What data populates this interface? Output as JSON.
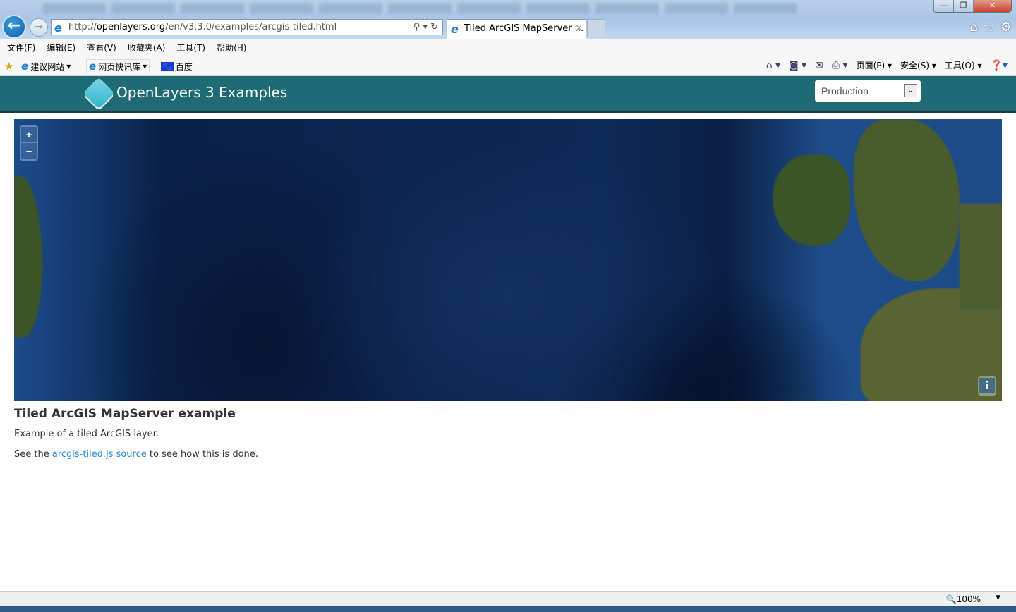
{
  "browser": {
    "address": {
      "prefix": "http://",
      "domain": "openlayers.org",
      "path": "/en/v3.3.0/examples/arcgis-tiled.html"
    },
    "tab_title": "Tiled ArcGIS MapServer ...",
    "tab_close": "×",
    "window_controls": {
      "minimize": "—",
      "restore": "❐",
      "close": "✕"
    },
    "menu": [
      "文件(F)",
      "编辑(E)",
      "查看(V)",
      "收藏夹(A)",
      "工具(T)",
      "帮助(H)"
    ],
    "favorites": [
      "建议网站",
      "网页快讯库",
      "百度"
    ],
    "command_bar": [
      "页面(P)",
      "安全(S)",
      "工具(O)"
    ],
    "zoom_level": "100%"
  },
  "header": {
    "brand": "OpenLayers 3 Examples",
    "mode_select": "Production"
  },
  "map": {
    "zoom_in": "+",
    "zoom_out": "–",
    "attribution": "i"
  },
  "content": {
    "title": "Tiled ArcGIS MapServer example",
    "description": "Example of a tiled ArcGIS layer.",
    "source_prefix": "See the",
    "source_link": "arcgis-tiled.js source",
    "source_suffix": "to see how this is done."
  }
}
